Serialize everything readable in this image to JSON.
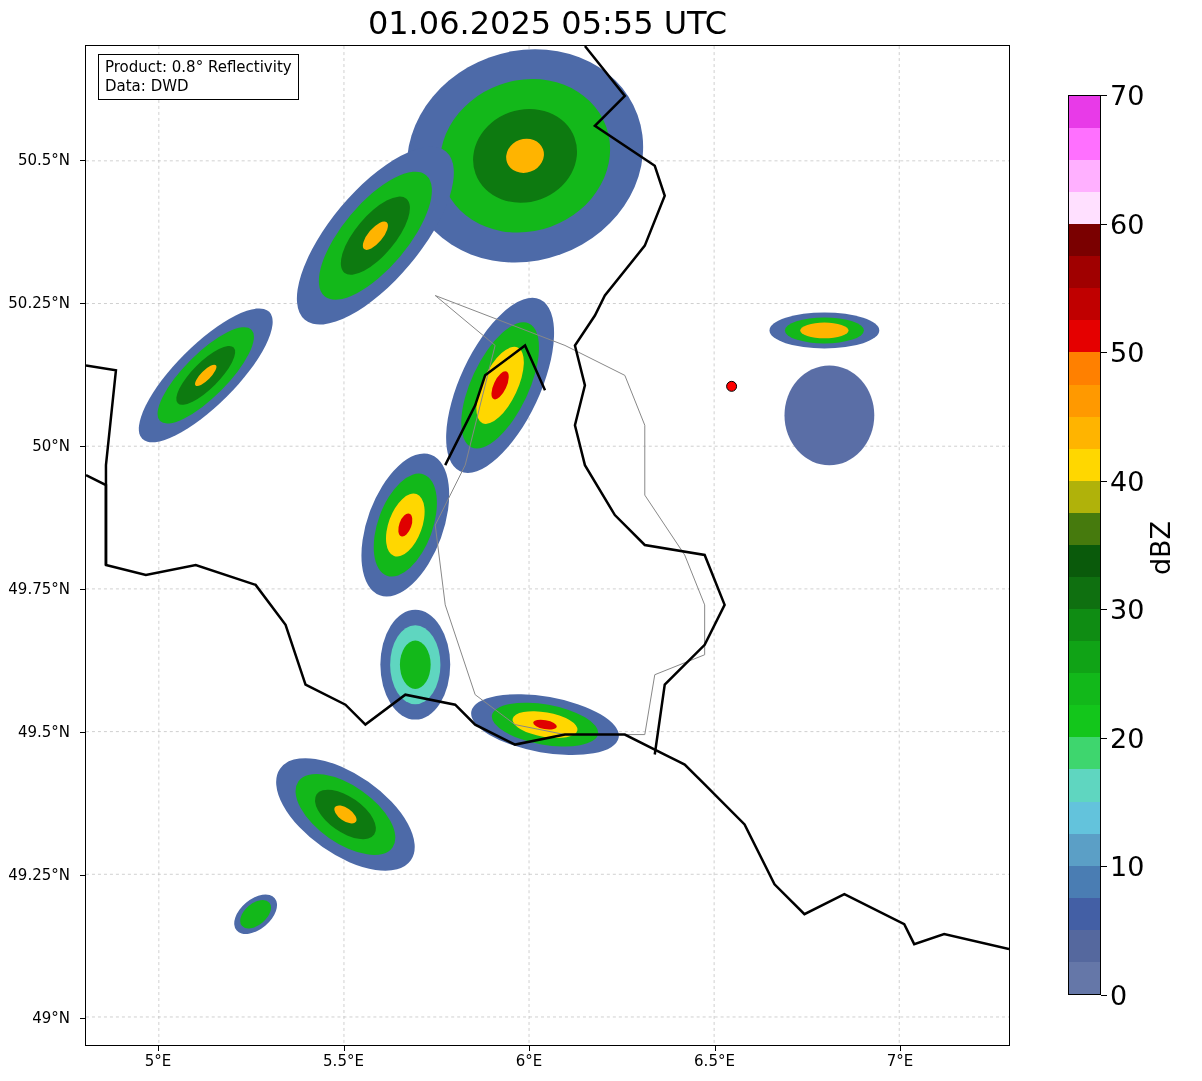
{
  "title": "01.06.2025 05:55 UTC",
  "info_box": {
    "lines": [
      "Product: 0.8° Reflectivity",
      "Data: DWD"
    ]
  },
  "axes": {
    "yticks": [
      "50.5°N",
      "50.25°N",
      "50°N",
      "49.75°N",
      "49.5°N",
      "49.25°N",
      "49°N"
    ],
    "xticks": [
      "5°E",
      "5.5°E",
      "6°E",
      "6.5°E",
      "7°E"
    ]
  },
  "colorbar": {
    "label": "dBZ",
    "ticks": [
      "70",
      "60",
      "50",
      "40",
      "30",
      "20",
      "10",
      "0"
    ],
    "bins": [
      {
        "color": "#6577a8"
      },
      {
        "color": "#55689e"
      },
      {
        "color": "#435fa5"
      },
      {
        "color": "#4a7db3"
      },
      {
        "color": "#5b9fc6"
      },
      {
        "color": "#63c3dc"
      },
      {
        "color": "#5fd6c0"
      },
      {
        "color": "#3ed66e"
      },
      {
        "color": "#13c61b"
      },
      {
        "color": "#12b81a"
      },
      {
        "color": "#10a316"
      },
      {
        "color": "#0f8c13"
      },
      {
        "color": "#0f7010"
      },
      {
        "color": "#0a5a0b"
      },
      {
        "color": "#467a0d"
      },
      {
        "color": "#b0b20a"
      },
      {
        "color": "#ffd700"
      },
      {
        "color": "#ffb400"
      },
      {
        "color": "#ff9900"
      },
      {
        "color": "#ff8000"
      },
      {
        "color": "#e50000"
      },
      {
        "color": "#c00000"
      },
      {
        "color": "#a00000"
      },
      {
        "color": "#7a0000"
      },
      {
        "color": "#ffe0ff"
      },
      {
        "color": "#ffb0ff"
      },
      {
        "color": "#ff70ff"
      },
      {
        "color": "#e83ae8"
      }
    ]
  }
}
